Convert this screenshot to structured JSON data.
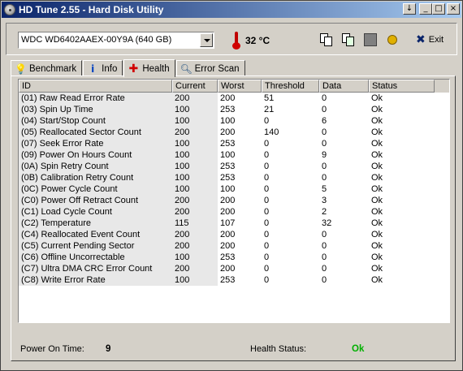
{
  "window": {
    "title": "HD Tune 2.55 - Hard Disk Utility",
    "buttons": [
      "↓",
      "_",
      "□",
      "×"
    ]
  },
  "toolbar": {
    "drive": "WDC WD6402AAEX-00Y9A (640 GB)",
    "temperature": "32 °C",
    "exit_label": "Exit",
    "icons": [
      "thermometer-icon",
      "copy-text-icon",
      "copy-image-icon",
      "save-icon",
      "options-icon",
      "exit-icon"
    ]
  },
  "tabs": [
    {
      "label": "Benchmark",
      "icon": "lightbulb-icon",
      "active": false
    },
    {
      "label": "Info",
      "icon": "info-icon",
      "active": false
    },
    {
      "label": "Health",
      "icon": "health-cross-icon",
      "active": true
    },
    {
      "label": "Error Scan",
      "icon": "magnifier-icon",
      "active": false
    }
  ],
  "table": {
    "headers": [
      "ID",
      "Current",
      "Worst",
      "Threshold",
      "Data",
      "Status"
    ],
    "rows": [
      [
        "(01) Raw Read Error Rate",
        "200",
        "200",
        "51",
        "0",
        "Ok"
      ],
      [
        "(03) Spin Up Time",
        "100",
        "253",
        "21",
        "0",
        "Ok"
      ],
      [
        "(04) Start/Stop Count",
        "100",
        "100",
        "0",
        "6",
        "Ok"
      ],
      [
        "(05) Reallocated Sector Count",
        "200",
        "200",
        "140",
        "0",
        "Ok"
      ],
      [
        "(07) Seek Error Rate",
        "100",
        "253",
        "0",
        "0",
        "Ok"
      ],
      [
        "(09) Power On Hours Count",
        "100",
        "100",
        "0",
        "9",
        "Ok"
      ],
      [
        "(0A) Spin Retry Count",
        "100",
        "253",
        "0",
        "0",
        "Ok"
      ],
      [
        "(0B) Calibration Retry Count",
        "100",
        "253",
        "0",
        "0",
        "Ok"
      ],
      [
        "(0C) Power Cycle Count",
        "100",
        "100",
        "0",
        "5",
        "Ok"
      ],
      [
        "(C0) Power Off Retract Count",
        "200",
        "200",
        "0",
        "3",
        "Ok"
      ],
      [
        "(C1) Load Cycle Count",
        "200",
        "200",
        "0",
        "2",
        "Ok"
      ],
      [
        "(C2) Temperature",
        "115",
        "107",
        "0",
        "32",
        "Ok"
      ],
      [
        "(C4) Reallocated Event Count",
        "200",
        "200",
        "0",
        "0",
        "Ok"
      ],
      [
        "(C5) Current Pending Sector",
        "200",
        "200",
        "0",
        "0",
        "Ok"
      ],
      [
        "(C6) Offline Uncorrectable",
        "100",
        "253",
        "0",
        "0",
        "Ok"
      ],
      [
        "(C7) Ultra DMA CRC Error Count",
        "200",
        "200",
        "0",
        "0",
        "Ok"
      ],
      [
        "(C8) Write Error Rate",
        "100",
        "253",
        "0",
        "0",
        "Ok"
      ]
    ]
  },
  "footer": {
    "power_on_label": "Power On Time:",
    "power_on_value": "9",
    "health_label": "Health Status:",
    "health_value": "Ok",
    "health_color": "#00b000"
  }
}
